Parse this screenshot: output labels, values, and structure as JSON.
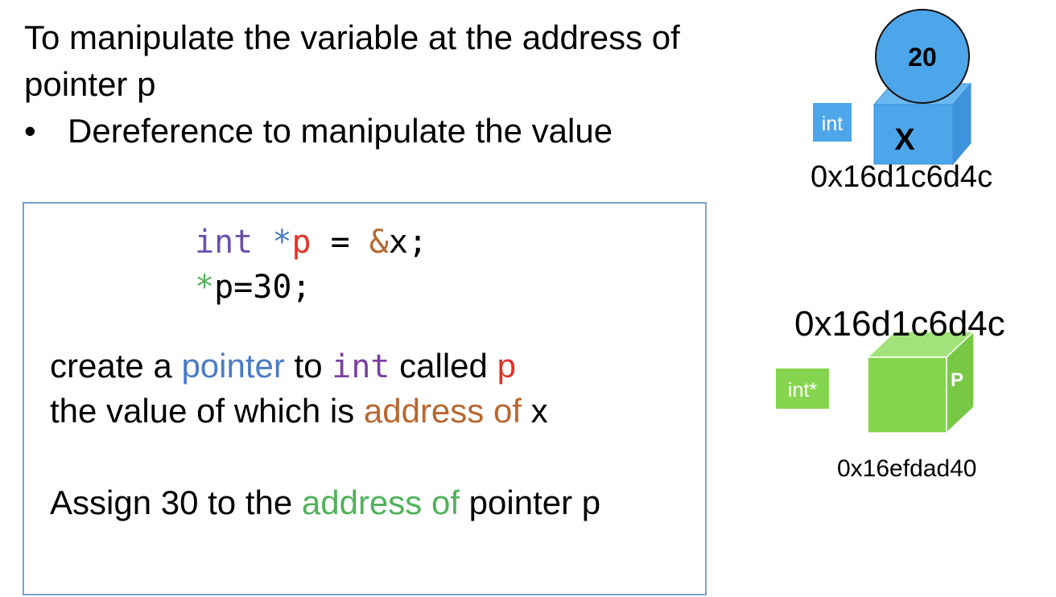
{
  "heading": {
    "line1": "To manipulate the variable at the address of",
    "line2": "pointer p"
  },
  "bullet": {
    "dot": "•",
    "text": "Dereference to manipulate the value"
  },
  "code": {
    "line1": {
      "kw": "int",
      "star": "*",
      "name": "p",
      "eq": " = ",
      "amp": "&",
      "rest": "x;"
    },
    "line2": {
      "star": "*",
      "rest": "p=30;"
    }
  },
  "explanation": {
    "line1": {
      "a": "create a ",
      "pointer": "pointer",
      "b": " to ",
      "int": "int",
      "c": " called ",
      "p": "p"
    },
    "line2": {
      "a": "the value of which is ",
      "addr": "address of",
      "b": " x"
    },
    "line3": {
      "a": "Assign 30 to the ",
      "addr": "address of",
      "b": " pointer p"
    }
  },
  "variable_x": {
    "value": "20",
    "name": "X",
    "type_label": "int",
    "address": "0x16d1c6d4c",
    "color": "#4ea6ea"
  },
  "pointer_p": {
    "stored_value": "0x16d1c6d4c",
    "name": "P",
    "type_label": "int*",
    "address": "0x16efdad40",
    "color": "#86d54f"
  },
  "colors": {
    "pointer_word": "#4a7bc7",
    "int_keyword": "#7b3fa3",
    "p_name": "#e0332b",
    "address_of": "#b8672f",
    "deref": "#50b25a",
    "box_border": "#7a9fd0"
  }
}
